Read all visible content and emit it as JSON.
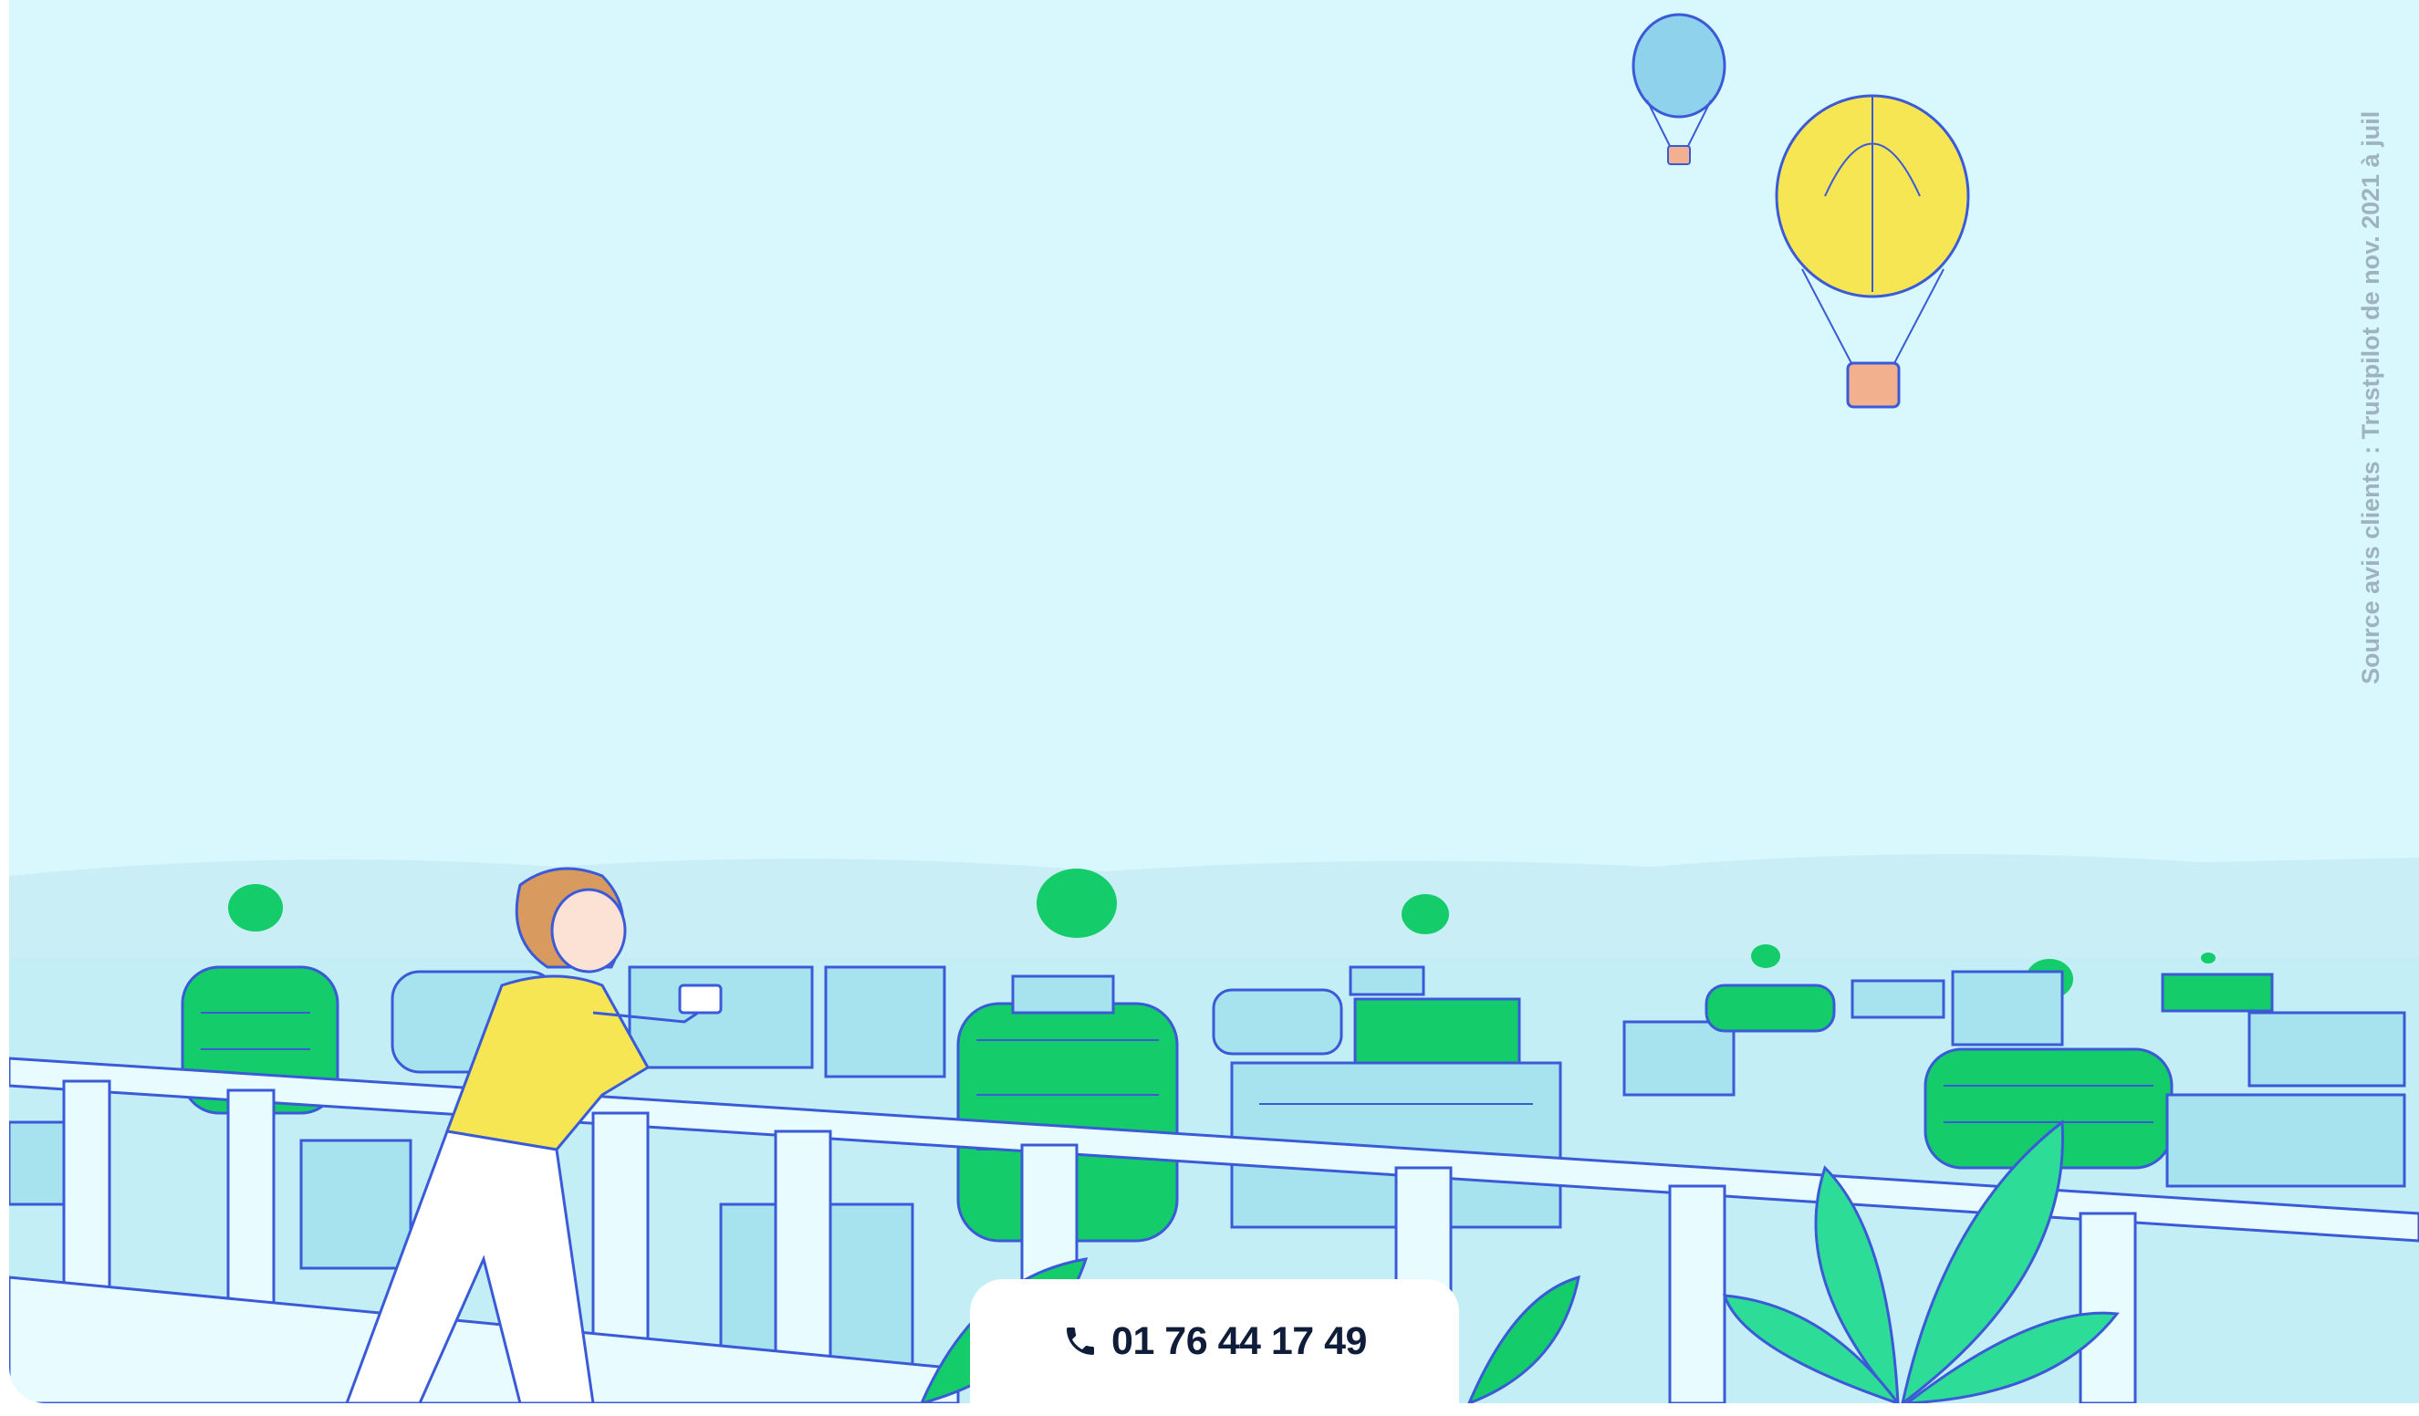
{
  "hero": {
    "source_text": "Source avis clients : Trustpilot de nov. 2021 à juil",
    "illustration": {
      "label": "",
      "colors": {
        "sky": "#d9f8fd",
        "building_light": "#a6e3ef",
        "building_green": "#14cc6a",
        "outline": "#3a5ad8",
        "balloon_yellow": "#f7e653",
        "balloon_blue": "#8fd2ec",
        "person_shirt": "#f7e653",
        "person_hair": "#d89a5e"
      }
    }
  },
  "contact": {
    "phone_icon": "phone-icon",
    "phone_number": "01 76 44 17 49"
  }
}
